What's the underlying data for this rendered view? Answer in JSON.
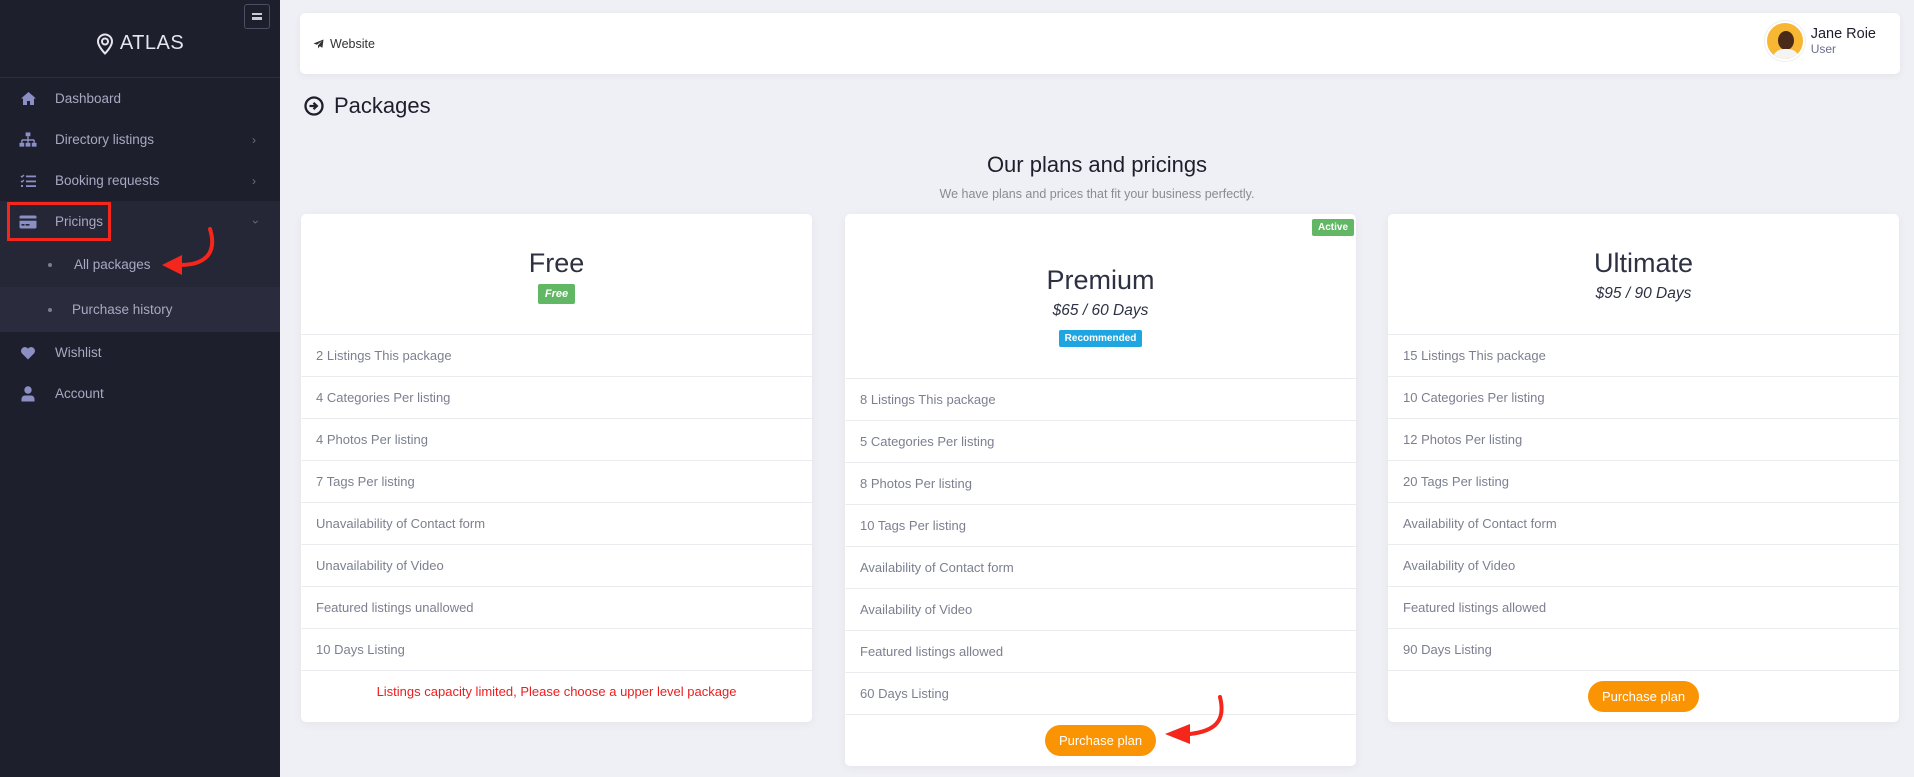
{
  "sidebar": {
    "brand": "ATLAS",
    "items": [
      {
        "label": "Dashboard",
        "icon": "home-icon"
      },
      {
        "label": "Directory listings",
        "icon": "sitemap-icon",
        "has_children": true
      },
      {
        "label": "Booking requests",
        "icon": "tasks-icon",
        "has_children": true
      },
      {
        "label": "Pricings",
        "icon": "credit-card-icon",
        "has_children": true,
        "expanded": true,
        "children": [
          {
            "label": "All packages"
          },
          {
            "label": "Purchase history"
          }
        ]
      },
      {
        "label": "Wishlist",
        "icon": "heart-icon"
      },
      {
        "label": "Account",
        "icon": "user-icon"
      }
    ]
  },
  "topbar": {
    "website_label": "Website",
    "user": {
      "name": "Jane Roie",
      "role": "User"
    }
  },
  "page": {
    "title": "Packages",
    "section_title": "Our plans and pricings",
    "section_subtitle": "We have plans and prices that fit your business perfectly."
  },
  "plans": [
    {
      "name": "Free",
      "badge": "Free",
      "features": [
        "2 Listings This package",
        "4 Categories Per listing",
        "4 Photos Per listing",
        "7 Tags Per listing",
        "Unavailability of Contact form",
        "Unavailability of Video",
        "Featured listings unallowed",
        "10 Days Listing"
      ],
      "footer_message": "Listings capacity limited, Please choose a upper level package"
    },
    {
      "name": "Premium",
      "price": "$65 / 60 Days",
      "badge": "Recommended",
      "status": "Active",
      "features": [
        "8 Listings This package",
        "5 Categories Per listing",
        "8 Photos Per listing",
        "10 Tags Per listing",
        "Availability of Contact form",
        "Availability of Video",
        "Featured listings allowed",
        "60 Days Listing"
      ],
      "button": "Purchase plan"
    },
    {
      "name": "Ultimate",
      "price": "$95 / 90 Days",
      "features": [
        "15 Listings This package",
        "10 Categories Per listing",
        "12 Photos Per listing",
        "20 Tags Per listing",
        "Availability of Contact form",
        "Availability of Video",
        "Featured listings allowed",
        "90 Days Listing"
      ],
      "button": "Purchase plan"
    }
  ],
  "colors": {
    "sidebar_bg": "#1e1f2c",
    "accent_orange": "#fb9402",
    "badge_green": "#61b764",
    "badge_blue": "#1fa6e0",
    "warning_red": "#ee1c1c",
    "annotation_red": "#f5261b"
  }
}
